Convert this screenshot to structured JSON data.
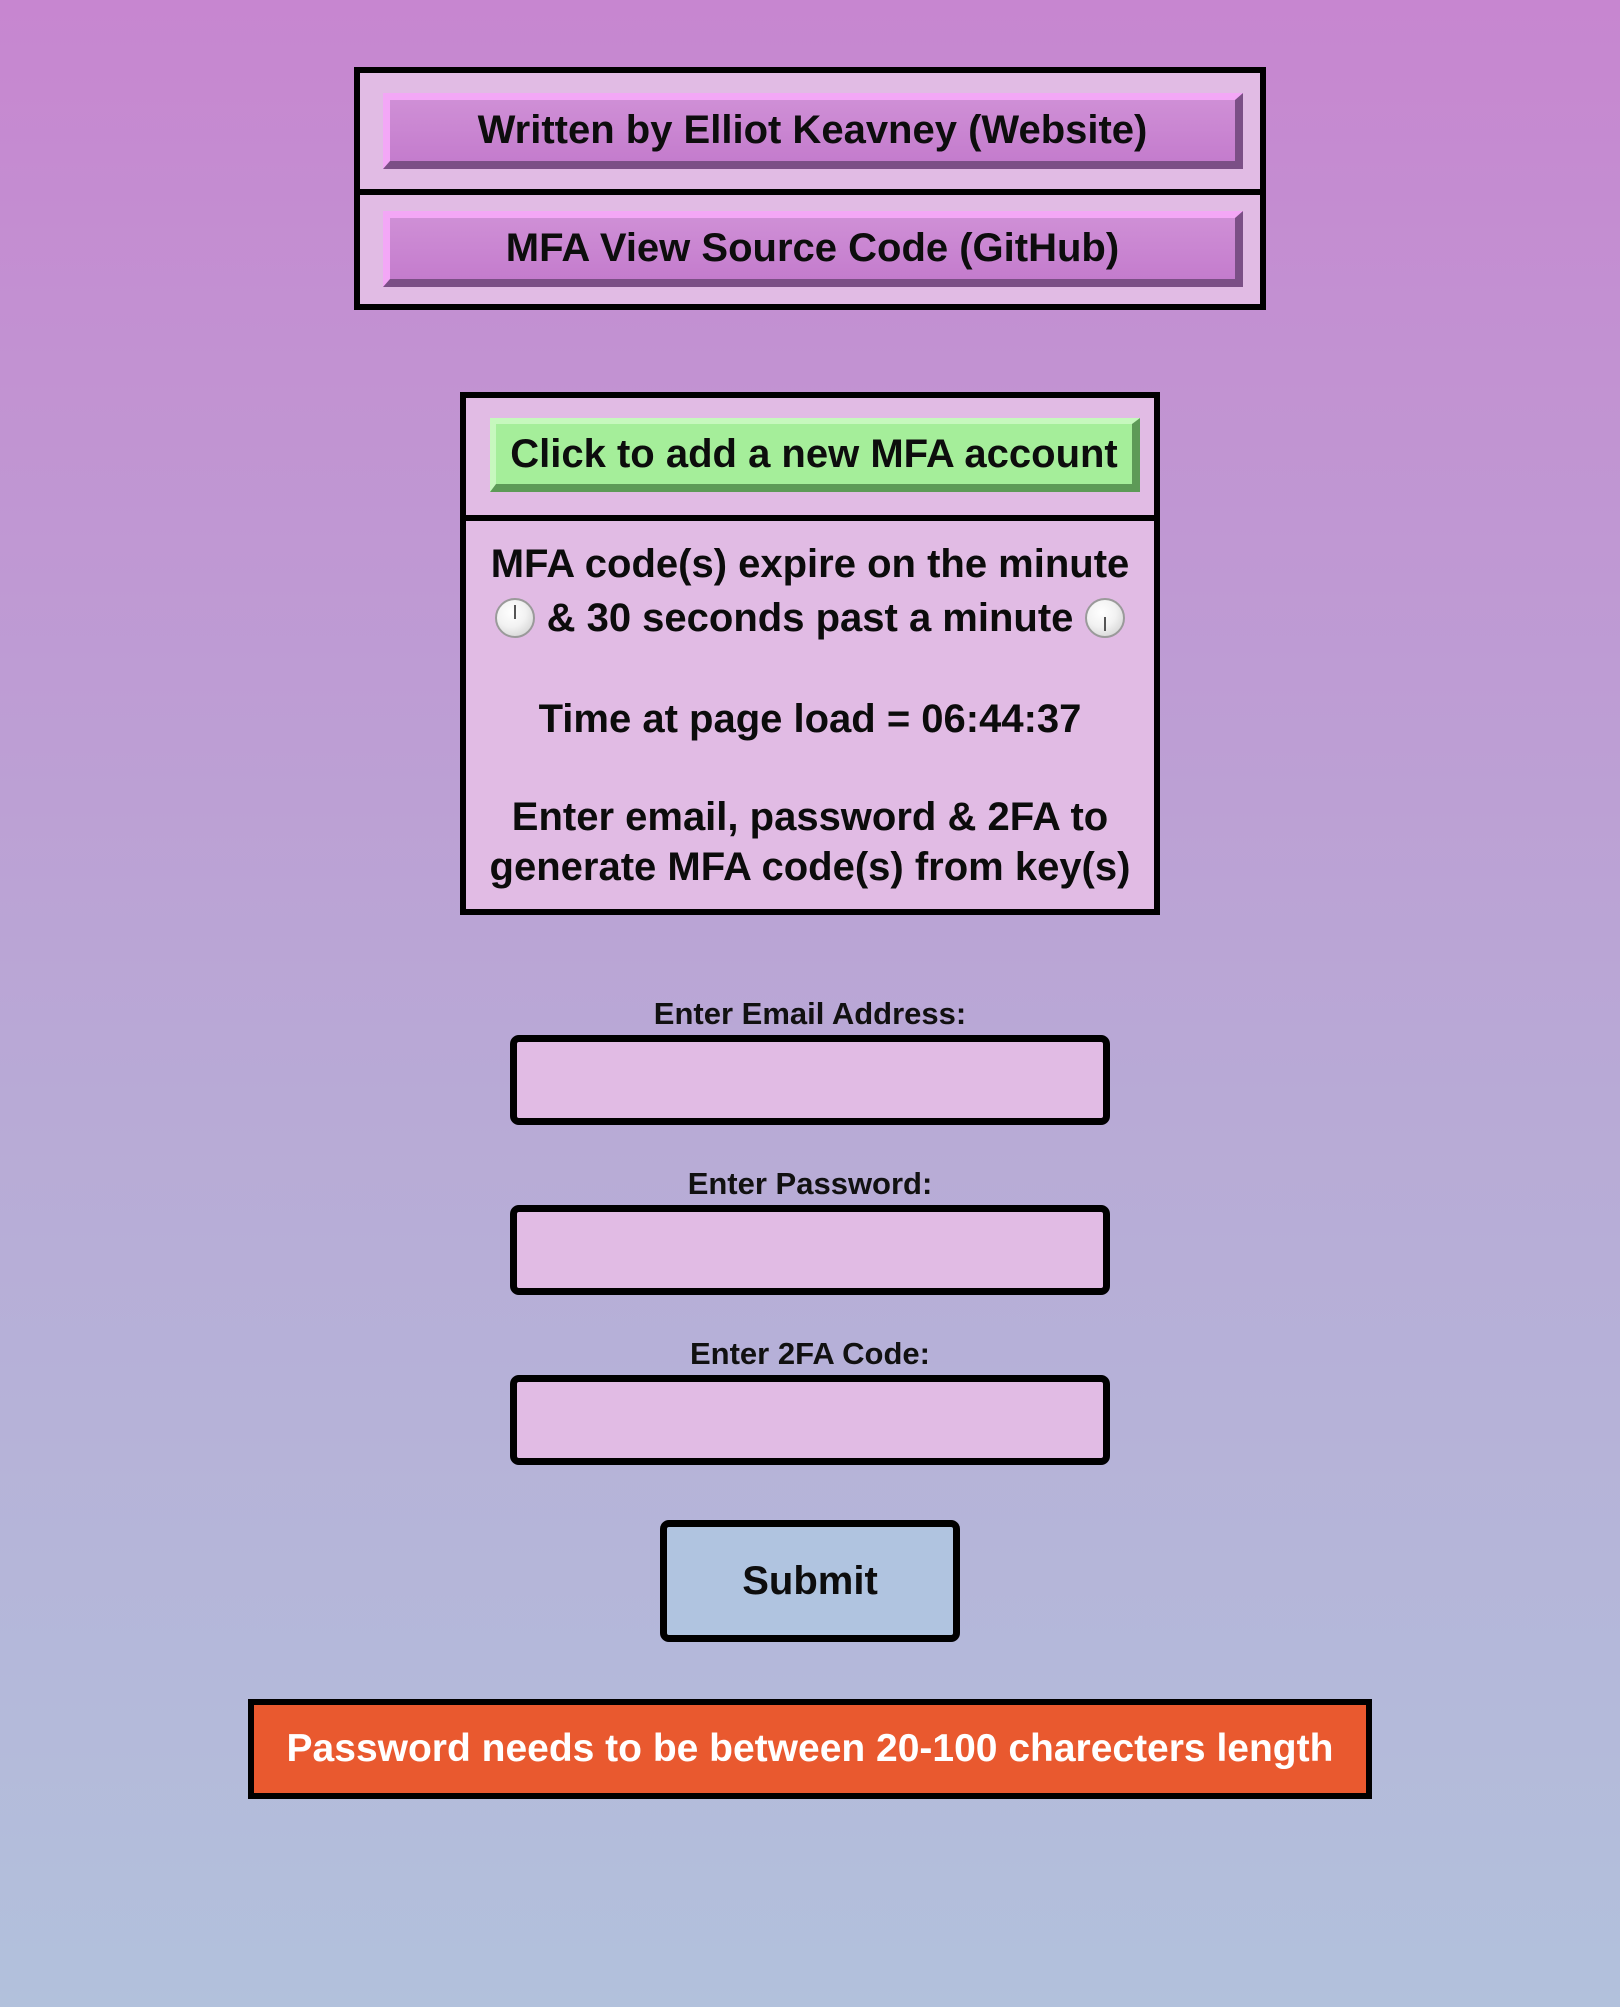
{
  "links": {
    "website_label": "Written by Elliot Keavney (Website)",
    "github_label": "MFA View Source Code (GitHub)"
  },
  "info": {
    "add_account_label": "Click to add a new MFA account",
    "expire_line1": "MFA code(s) expire on the minute",
    "expire_line2": "& 30 seconds past a minute",
    "time_at_load": "Time at page load = 06:44:37",
    "enter_line1": "Enter email, password & 2FA to",
    "enter_line2": "generate MFA code(s) from key(s)",
    "icons": [
      "clock-twelve-icon",
      "clock-twelve-thirty-icon"
    ]
  },
  "form": {
    "email_label": "Enter Email Address:",
    "email_value": "",
    "password_label": "Enter Password:",
    "password_value": "",
    "twofa_label": "Enter 2FA Code:",
    "twofa_value": "",
    "submit_label": "Submit"
  },
  "error": {
    "message": "Password needs to be between 20-100 charecters length",
    "color": "#e9592f"
  },
  "colors": {
    "panel": "#e1bbe4",
    "link_button": "#c47ccd",
    "add_button": "#a5ee9a",
    "submit_button": "#b0c4e0",
    "background_top": "#c786d0",
    "background_bottom": "#b2c1dc"
  }
}
